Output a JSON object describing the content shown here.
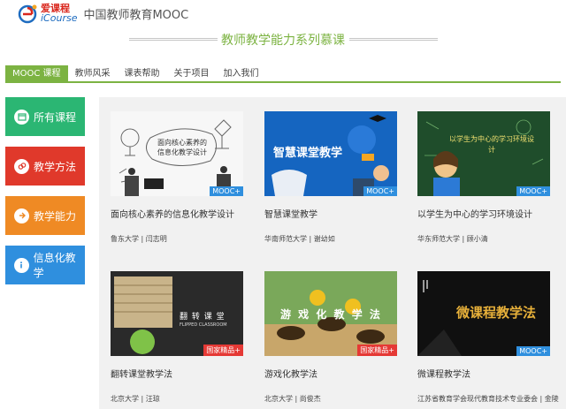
{
  "header": {
    "logo_cn": "爱课程",
    "logo_en": "iCourse",
    "site_title": "中国教师教育MOOC"
  },
  "banner": {
    "title": "教师教学能力系列慕课"
  },
  "nav": {
    "items": [
      "MOOC 课程",
      "教师风采",
      "课表帮助",
      "关于项目",
      "加入我们"
    ]
  },
  "sidebar": {
    "items": [
      {
        "label": "所有课程",
        "icon": "calendar-icon"
      },
      {
        "label": "教学方法",
        "icon": "link-icon"
      },
      {
        "label": "教学能力",
        "icon": "arrow-icon"
      },
      {
        "label": "信息化教学",
        "icon": "info-icon"
      }
    ]
  },
  "courses": [
    {
      "title": "面向核心素养的信息化教学设计",
      "school": "鲁东大学",
      "teacher": "闫志明",
      "badge": "MOOC+",
      "thumb_text": "面向核心素养的信息化教学设计"
    },
    {
      "title": "智慧课堂教学",
      "school": "华南师范大学",
      "teacher": "谢幼如",
      "badge": "MOOC+",
      "thumb_text": "智慧课堂教学"
    },
    {
      "title": "以学生为中心的学习环境设计",
      "school": "华东师范大学",
      "teacher": "顾小清",
      "badge": "MOOC+",
      "thumb_text": "以学生为中心的学习环境设计"
    },
    {
      "title": "翻转课堂教学法",
      "school": "北京大学",
      "teacher": "汪琼",
      "badge": "国家精品+",
      "thumb_text": "翻 转 课 堂",
      "thumb_sub": "FLIPPED CLASSROOM"
    },
    {
      "title": "游戏化教学法",
      "school": "北京大学",
      "teacher": "尚俊杰",
      "badge": "国家精品+",
      "thumb_text": "游 戏 化 教 学 法"
    },
    {
      "title": "微课程教学法",
      "school": "江苏省教育学会现代教育技术专业委会",
      "teacher": "金陵",
      "badge": "MOOC+",
      "thumb_text": "微课程教学法"
    }
  ]
}
